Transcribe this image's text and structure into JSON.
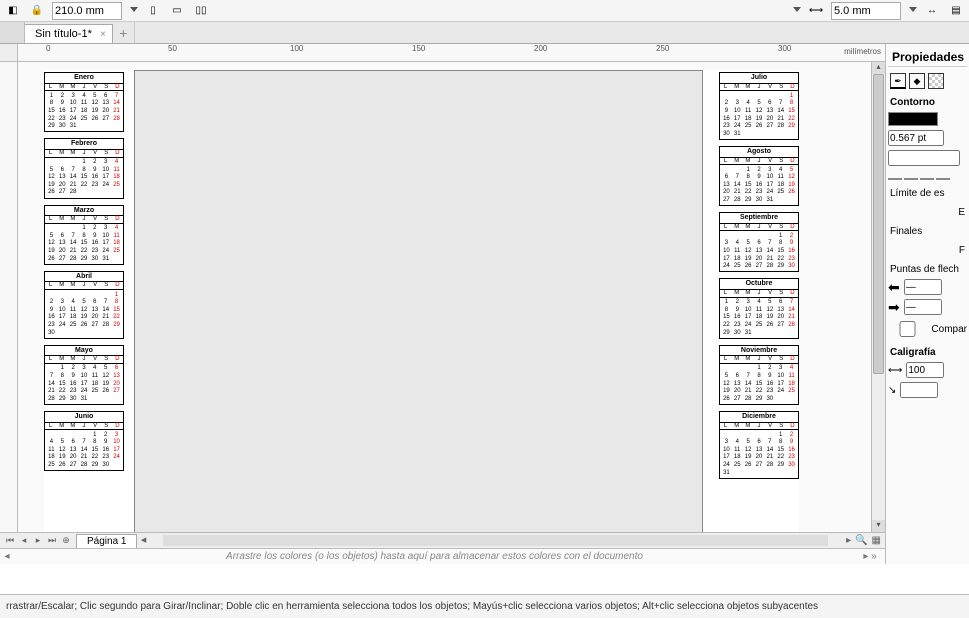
{
  "toolbar": {
    "width_value": "210.0 mm",
    "nudge_value": "5.0 mm"
  },
  "tab": {
    "title": "Sin título-1*"
  },
  "ruler": {
    "unit": "milímetros",
    "ticks": [
      "0",
      "50",
      "100",
      "150",
      "200",
      "250",
      "300"
    ]
  },
  "pagebar": {
    "label": "Página 1"
  },
  "colorbar_hint": "Arrastre los colores (o los objetos) hasta aquí para almacenar estos colores con el documento",
  "status": "rrastrar/Escalar; Clic segundo para Girar/Inclinar; Doble clic en herramienta selecciona todos los objetos; Mayús+clic selecciona varios objetos; Alt+clic selecciona objetos subyacentes",
  "props": {
    "title": "Propiedades",
    "section_outline": "Contorno",
    "stroke_width": "0.567 pt",
    "limit_label": "Límite de es",
    "ends_label": "Finales",
    "arrows_label": "Puntas de flech",
    "share_label": "Compar",
    "calig_label": "Caligrafía",
    "calig_value": "100"
  },
  "day_headers": [
    "L",
    "M",
    "M",
    "J",
    "V",
    "S",
    "D"
  ],
  "months_left": [
    {
      "name": "Enero",
      "offset": 0,
      "days": 31
    },
    {
      "name": "Febrero",
      "offset": 3,
      "days": 28
    },
    {
      "name": "Marzo",
      "offset": 3,
      "days": 31
    },
    {
      "name": "Abril",
      "offset": 6,
      "days": 30
    },
    {
      "name": "Mayo",
      "offset": 1,
      "days": 31
    },
    {
      "name": "Junio",
      "offset": 4,
      "days": 30
    }
  ],
  "months_right": [
    {
      "name": "Julio",
      "offset": 6,
      "days": 31
    },
    {
      "name": "Agosto",
      "offset": 2,
      "days": 31
    },
    {
      "name": "Septiembre",
      "offset": 5,
      "days": 30
    },
    {
      "name": "Octubre",
      "offset": 0,
      "days": 31
    },
    {
      "name": "Noviembre",
      "offset": 3,
      "days": 30
    },
    {
      "name": "Diciembre",
      "offset": 5,
      "days": 31
    }
  ]
}
